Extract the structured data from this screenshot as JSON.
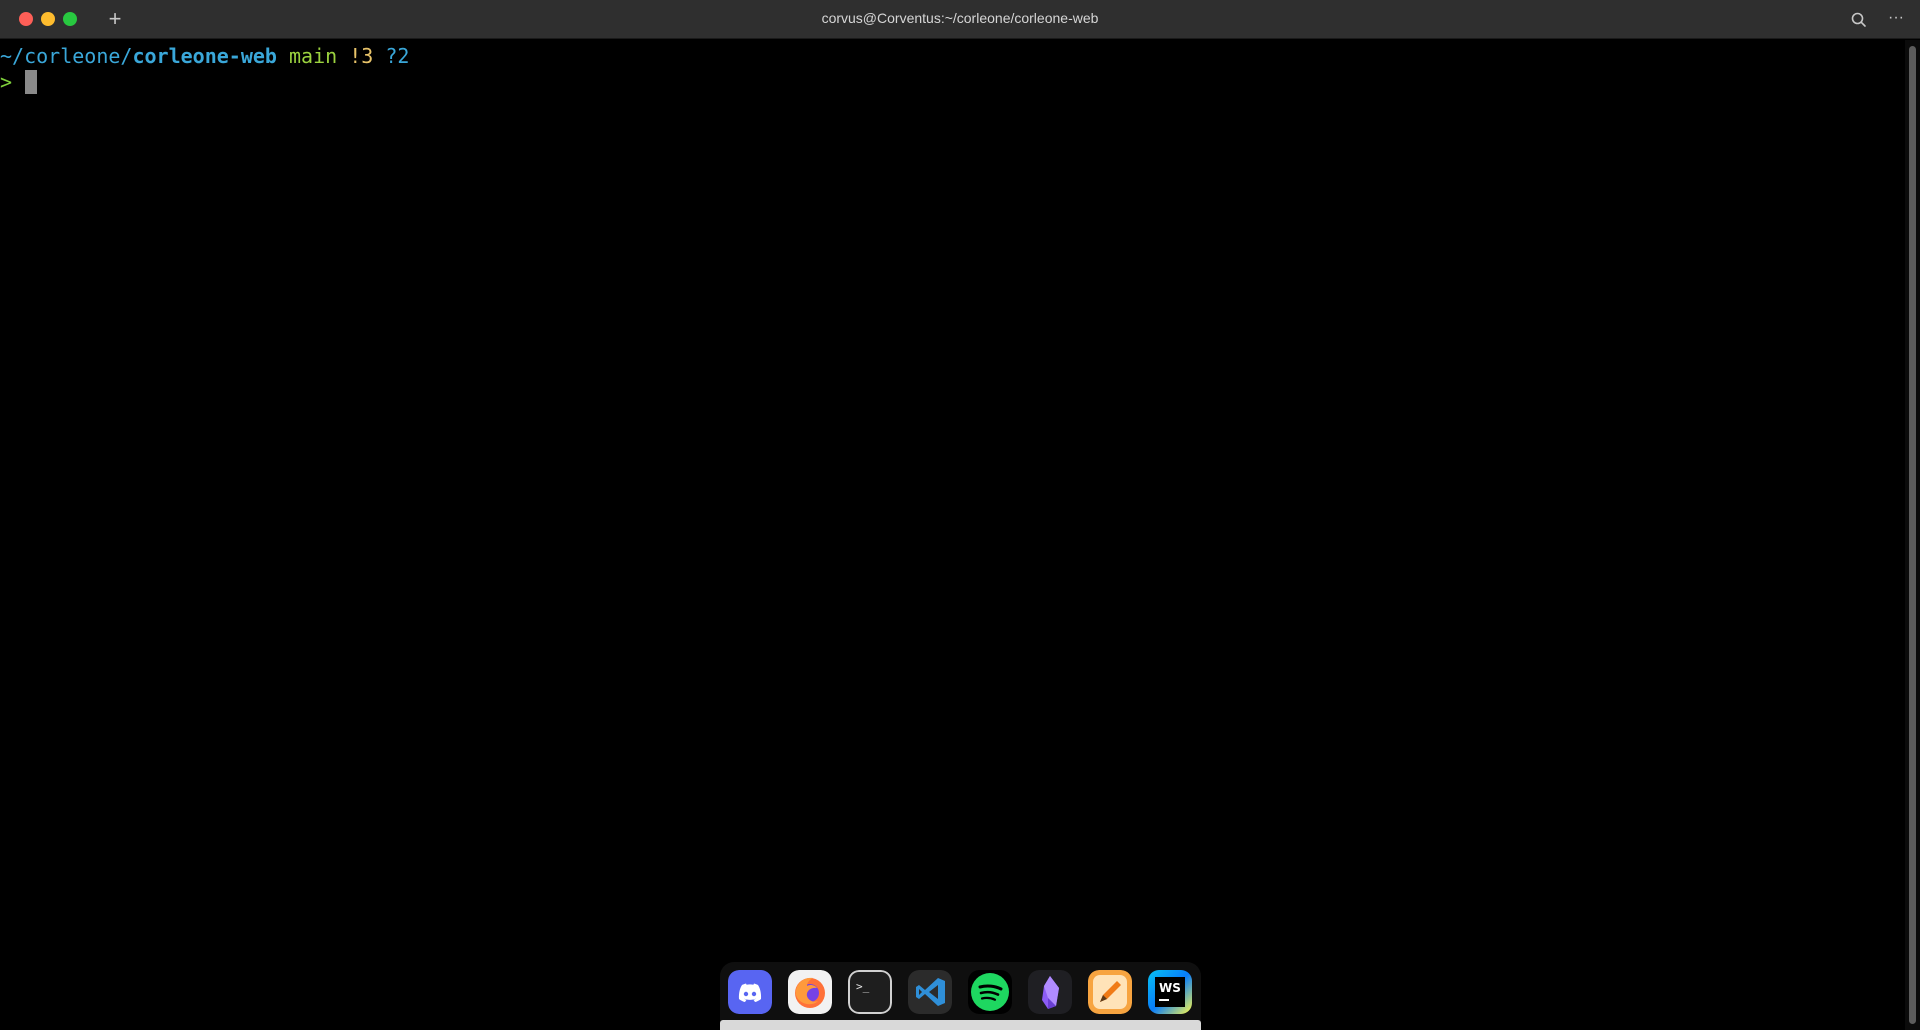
{
  "window": {
    "title": "corvus@Corventus:~/corleone/corleone-web",
    "new_tab_glyph": "+",
    "more_glyph": "···"
  },
  "prompt": {
    "path_prefix": "~/corleone/",
    "current_dir": "corleone-web",
    "branch": "main",
    "modified": "!3",
    "untracked": "?2",
    "prompt_char": ">"
  },
  "dock": {
    "apps": [
      {
        "name": "Discord",
        "icon": "discord-icon"
      },
      {
        "name": "Firefox",
        "icon": "firefox-icon"
      },
      {
        "name": "Terminal",
        "icon": "terminal-icon"
      },
      {
        "name": "Visual Studio Code",
        "icon": "vscode-icon"
      },
      {
        "name": "Spotify",
        "icon": "spotify-icon"
      },
      {
        "name": "Obsidian",
        "icon": "obsidian-icon"
      },
      {
        "name": "Sketchbook",
        "icon": "pencil-app-icon"
      },
      {
        "name": "WebStorm",
        "icon": "webstorm-icon",
        "label": "WS"
      }
    ]
  },
  "colors": {
    "titlebar": "#2f2f2f",
    "path": "#3aa7d9",
    "branch": "#9bd23f",
    "modified": "#e9c46a",
    "prompt": "#7fd13b"
  }
}
